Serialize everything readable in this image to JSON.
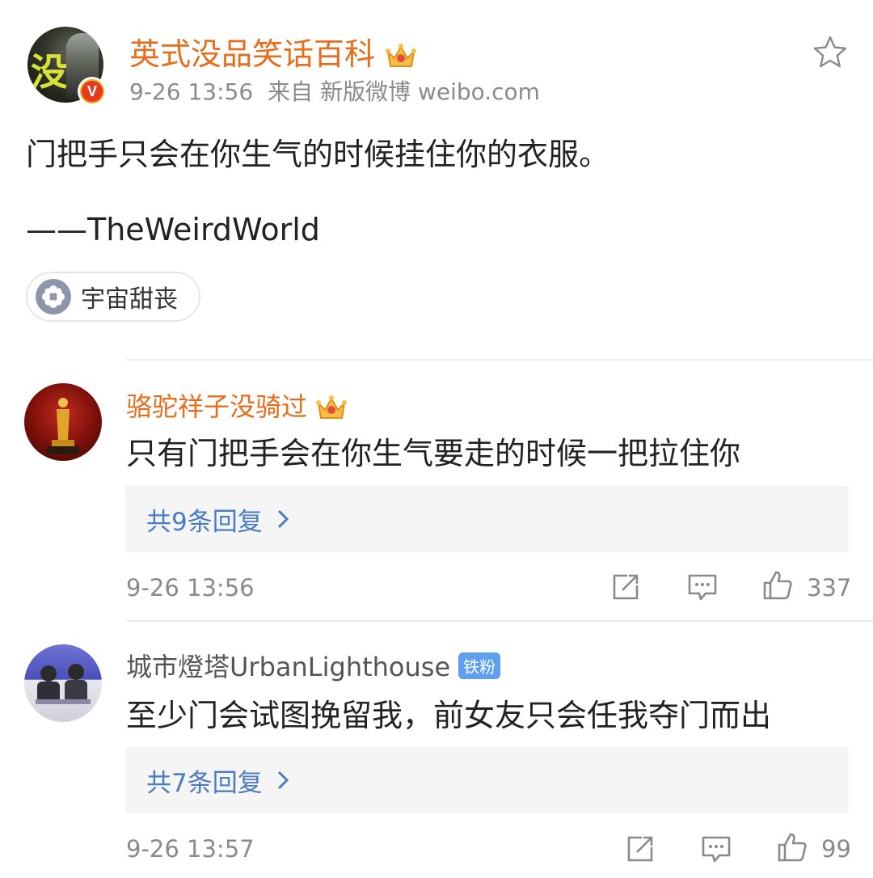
{
  "post": {
    "author": "英式没品笑话百科",
    "time": "9-26 13:56",
    "source": "来自 新版微博 weibo.com",
    "text": "门把手只会在你生气的时候挂住你的衣服。",
    "signature": "——TheWeirdWorld",
    "topic": "宇宙甜丧",
    "verified_badge": "V"
  },
  "comments": [
    {
      "author": "骆驼祥子没骑过",
      "text": "只有门把手会在你生气要走的时候一把拉住你",
      "replies": "共9条回复",
      "time": "9-26 13:56",
      "likes": "337",
      "avatar_icon": "oscar-statue-avatar"
    },
    {
      "author": "城市燈塔UrbanLighthouse",
      "badge": "铁粉",
      "text": "至少门会试图挽留我，前女友只会任我夺门而出",
      "replies": "共7条回复",
      "time": "9-26 13:57",
      "likes": "99",
      "avatar_icon": "two-people-avatar"
    }
  ],
  "icons": {
    "star": "star-icon",
    "repost": "repost-icon",
    "comment": "comment-icon",
    "like": "thumbs-up-icon",
    "chevron": "chevron-right-icon",
    "crown": "crown-icon"
  },
  "colors": {
    "author_orange": "#e86d1a",
    "link_blue": "#4a7cc4",
    "meta_gray": "#8a8a8a",
    "verified_orange": "#f5a623"
  }
}
